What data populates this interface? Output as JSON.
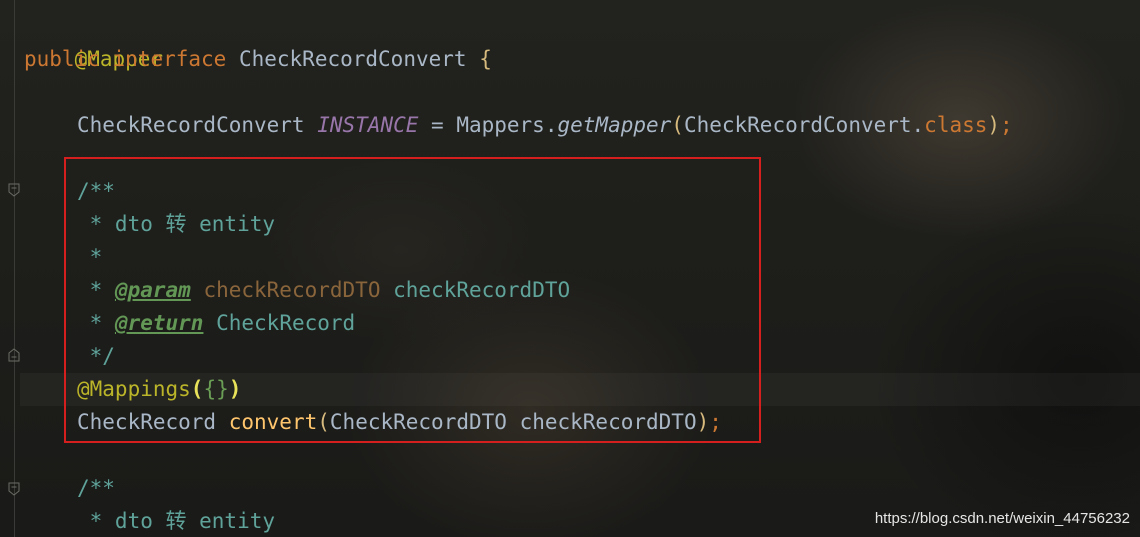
{
  "code": {
    "line_mapper": "@Mapper",
    "line_interface": {
      "kw_public": "public",
      "kw_interface": "interface",
      "name": "CheckRecordConvert",
      "brace": "{"
    },
    "line_instance": {
      "type": "CheckRecordConvert",
      "const": "INSTANCE",
      "eq": " = ",
      "mappers": "Mappers",
      "dot": ".",
      "method": "getMapper",
      "paren_open": "(",
      "arg": "CheckRecordConvert.",
      "class_kw": "class",
      "paren_close": ")",
      "semi": ";"
    },
    "doc1": {
      "open": "/**",
      "desc": " * dto 转 entity",
      "blank": " *",
      "param_prefix": " * ",
      "param_tag": "@param",
      "param_name": "checkRecordDTO",
      "param_desc": "checkRecordDTO",
      "return_prefix": " * ",
      "return_tag": "@return",
      "return_desc": "CheckRecord",
      "close": " */"
    },
    "line_mappings": {
      "ann": "@Mappings",
      "paren_open": "(",
      "inner": "{}",
      "paren_close": ")"
    },
    "line_convert": {
      "ret_type": "CheckRecord",
      "method": "convert",
      "paren_open": "(",
      "param_type": "CheckRecordDTO",
      "param_name": "checkRecordDTO",
      "paren_close": ")",
      "semi": ";"
    },
    "doc2": {
      "open": "/**",
      "desc": " * dto 转 entity"
    }
  },
  "watermark": "https://blog.csdn.net/weixin_44756232",
  "colors": {
    "annotation": "#bbb529",
    "keyword": "#cc7832",
    "identifier": "#a9b7c6",
    "constant": "#9876aa",
    "doc_comment": "#5fa39a",
    "doc_tag": "#629755",
    "method_declaration": "#ffc66d",
    "highlight_box": "#d51f1f"
  }
}
